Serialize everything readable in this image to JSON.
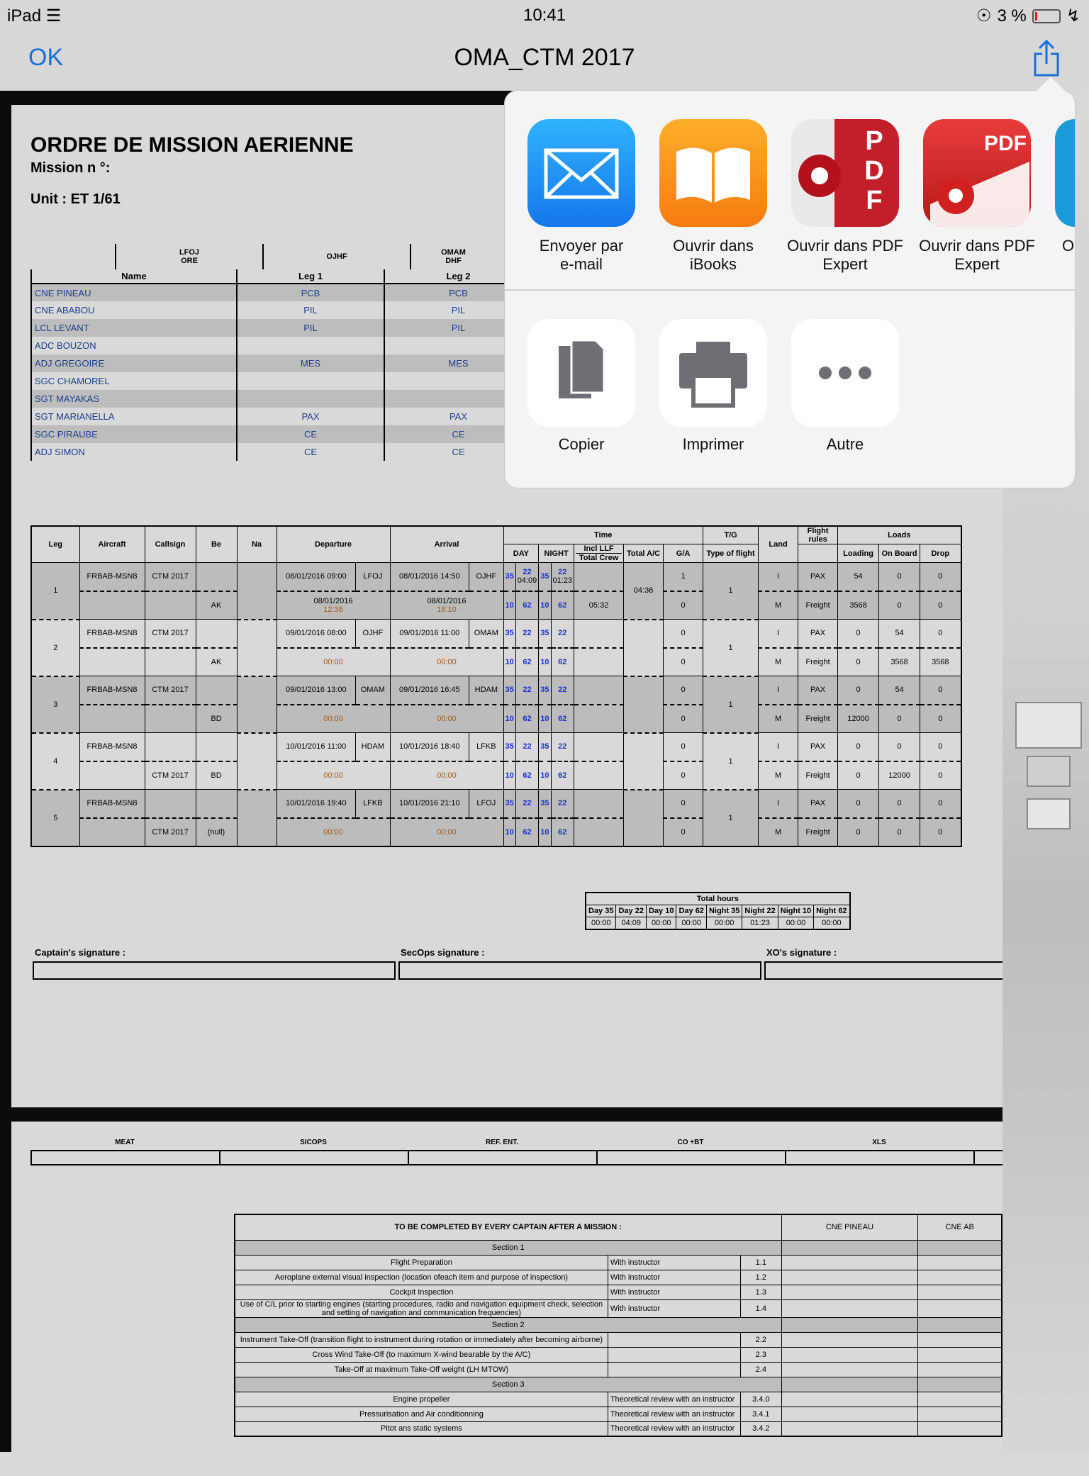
{
  "status": {
    "device": "iPad",
    "time": "10:41",
    "battery": "3 %"
  },
  "nav": {
    "ok": "OK",
    "title": "OMA_CTM 2017"
  },
  "doc": {
    "title": "ORDRE DE MISSION AERIENNE",
    "mission": "Mission n °:",
    "unit": "Unit : ET 1/61",
    "airports": [
      "LFOJ\nORE",
      "OJHF",
      "OMAM\nDHF"
    ],
    "crew_headers": [
      "Name",
      "Leg 1",
      "Leg 2"
    ],
    "crew": [
      [
        "CNE PINEAU",
        "PCB",
        "PCB"
      ],
      [
        "CNE ABABOU",
        "PIL",
        "PIL"
      ],
      [
        "LCL LEVANT",
        "PIL",
        "PIL"
      ],
      [
        "ADC BOUZON",
        "",
        ""
      ],
      [
        "ADJ GREGOIRE",
        "MES",
        "MES"
      ],
      [
        "SGC CHAMOREL",
        "",
        ""
      ],
      [
        "SGT MAYAKAS",
        "",
        ""
      ],
      [
        "SGT MARIANELLA",
        "PAX",
        "PAX"
      ],
      [
        "SGC PIRAUBE",
        "CE",
        "CE"
      ],
      [
        "ADJ SIMON",
        "CE",
        "CE"
      ]
    ],
    "crew_overflow": [
      "CE",
      "CE",
      "CE"
    ],
    "legs_headers": {
      "leg": "Leg",
      "aircraft": "Aircraft",
      "callsign": "Callsign",
      "be": "Be",
      "na": "Na",
      "dep": "Departure",
      "arr": "Arrival",
      "time": "Time",
      "day": "DAY",
      "night": "NIGHT",
      "incl": "Incl LLF",
      "totalcrew": "Total Crew",
      "totalac": "Total A/C",
      "tg": "T/G",
      "ga": "G/A",
      "land": "Land",
      "rules": "Flight rules",
      "type": "Type of flight",
      "loads": "Loads",
      "loading": "Loading",
      "onboard": "On Board",
      "drop": "Drop"
    },
    "legs": [
      {
        "n": "1",
        "ac": "FRBAB-MSN8",
        "cs": "CTM 2017",
        "be": "",
        "dep": "08/01/2016 09:00",
        "depa": "LFOJ",
        "arr": "08/01/2016 14:50",
        "arra": "OJHF",
        "d1": "35",
        "d2": "22",
        "d2b": "04:09",
        "n1": "35",
        "n2": "22",
        "n2b": "01:23",
        "tg": "1",
        "land": "1",
        "totalac": "04:36",
        "ld1": "54",
        "ob1": "0",
        "dr1": "0",
        "be2": "AK",
        "cs2": "",
        "dep2": "08/01/2016",
        "dept": "12:38",
        "arr2": "08/01/2016",
        "arrt": "18:10",
        "tc": "05:32",
        "tg2": "0",
        "ld2": "3568",
        "ob2": "0",
        "dr2": "0"
      },
      {
        "n": "2",
        "ac": "FRBAB-MSN8",
        "cs": "CTM 2017",
        "be": "",
        "dep": "09/01/2016 08:00",
        "depa": "OJHF",
        "arr": "09/01/2016 11:00",
        "arra": "OMAM",
        "d1": "35",
        "d2": "22",
        "d2b": "",
        "n1": "35",
        "n2": "22",
        "n2b": "",
        "tg": "0",
        "land": "1",
        "totalac": "",
        "ld1": "0",
        "ob1": "54",
        "dr1": "0",
        "be2": "AK",
        "cs2": "",
        "dep2": "",
        "dept": "00:00",
        "arr2": "",
        "arrt": "00:00",
        "tc": "",
        "tg2": "0",
        "ld2": "0",
        "ob2": "3568",
        "dr2": "3568"
      },
      {
        "n": "3",
        "ac": "FRBAB-MSN8",
        "cs": "CTM 2017",
        "be": "",
        "dep": "09/01/2016 13:00",
        "depa": "OMAM",
        "arr": "09/01/2016 16:45",
        "arra": "HDAM",
        "d1": "35",
        "d2": "22",
        "d2b": "",
        "n1": "35",
        "n2": "22",
        "n2b": "",
        "tg": "0",
        "land": "1",
        "totalac": "",
        "ld1": "0",
        "ob1": "54",
        "dr1": "0",
        "be2": "BD",
        "cs2": "",
        "dep2": "",
        "dept": "00:00",
        "arr2": "",
        "arrt": "00:00",
        "tc": "",
        "tg2": "0",
        "ld2": "12000",
        "ob2": "0",
        "dr2": "0"
      },
      {
        "n": "4",
        "ac": "FRBAB-MSN8",
        "cs": "",
        "be": "",
        "dep": "10/01/2016 11:00",
        "depa": "HDAM",
        "arr": "10/01/2016 18:40",
        "arra": "LFKB",
        "d1": "35",
        "d2": "22",
        "d2b": "",
        "n1": "35",
        "n2": "22",
        "n2b": "",
        "tg": "0",
        "land": "1",
        "totalac": "",
        "ld1": "0",
        "ob1": "0",
        "dr1": "0",
        "be2": "BD",
        "cs2": "CTM 2017",
        "dep2": "",
        "dept": "00:00",
        "arr2": "",
        "arrt": "00:00",
        "tc": "",
        "tg2": "0",
        "ld2": "0",
        "ob2": "12000",
        "dr2": "0"
      },
      {
        "n": "5",
        "ac": "FRBAB-MSN8",
        "cs": "",
        "be": "",
        "dep": "10/01/2016 19:40",
        "depa": "LFKB",
        "arr": "10/01/2016 21:10",
        "arra": "LFOJ",
        "d1": "35",
        "d2": "22",
        "d2b": "",
        "n1": "35",
        "n2": "22",
        "n2b": "",
        "tg": "0",
        "land": "1",
        "totalac": "",
        "ld1": "0",
        "ob1": "0",
        "dr1": "0",
        "be2": "(null)",
        "cs2": "CTM 2017",
        "dep2": "",
        "dept": "00:00",
        "arr2": "",
        "arrt": "00:00",
        "tc": "",
        "tg2": "0",
        "ld2": "0",
        "ob2": "0",
        "dr2": "0"
      }
    ],
    "leg_sub": {
      "d1": "10",
      "d2": "62",
      "n1": "10",
      "n2": "62",
      "rules1": "I",
      "rules2": "M",
      "pax": "PAX",
      "freight": "Freight"
    },
    "total_hours": {
      "title": "Total hours",
      "cols": [
        "Day 35",
        "Day 22",
        "Day 10",
        "Day 62",
        "Night 35",
        "Night 22",
        "Night 10",
        "Night 62"
      ],
      "vals": [
        "00:00",
        "04:09",
        "00:00",
        "00:00",
        "00:00",
        "01:23",
        "00:00",
        "00:00"
      ]
    },
    "signatures": [
      "Captain's signature :",
      "SecOps signature :",
      "XO's signature :"
    ],
    "p2_headers": [
      "MEAT",
      "SICOPS",
      "REF. ENT.",
      "CO +BT",
      "XLS"
    ],
    "checklist": {
      "title": "TO BE COMPLETED BY EVERY CAPTAIN AFTER A MISSION :",
      "capt1": "CNE PINEAU",
      "capt2": "CNE AB",
      "rows": [
        {
          "sec": "Section 1"
        },
        {
          "t": "Flight Preparation",
          "w": "With instructor",
          "c": "1.1"
        },
        {
          "t": "Aeroplane external visual inspection (location ofeach item and purpose of inspection)",
          "w": "With instructor",
          "c": "1.2"
        },
        {
          "t": "Cockpit Inspection",
          "w": "With instructor",
          "c": "1.3"
        },
        {
          "t": "Use of C/L prior to starting engines (starting procedures, radio and navigation equipment check, selection and setting of navigation and communication frequencies)",
          "w": "With instructor",
          "c": "1.4"
        },
        {
          "sec": "Section 2"
        },
        {
          "t": "Instrument Take-Off (transition flight to instrument during rotation or immediately after becoming airborne)",
          "w": "",
          "c": "2.2"
        },
        {
          "t": "Cross Wind Take-Off (to maximum X-wind bearable by the A/C)",
          "w": "",
          "c": "2.3"
        },
        {
          "t": "Take-Off at maximum Take-Off weight (LH MTOW)",
          "w": "",
          "c": "2.4"
        },
        {
          "sec": "Section 3"
        },
        {
          "t": "Engine propeller",
          "w": "Theoretical review with an instructor",
          "c": "3.4.0"
        },
        {
          "t": "Pressurisation and Air conditionning",
          "w": "Theoretical review with an instructor",
          "c": "3.4.1"
        },
        {
          "t": "Pitot ans static systems",
          "w": "Theoretical review with an instructor",
          "c": "3.4.2"
        }
      ]
    }
  },
  "share": {
    "apps": [
      "Envoyer par\ne-mail",
      "Ouvrir dans\niBooks",
      "Ouvrir dans PDF\nExpert",
      "Ouvrir dans PDF\nExpert",
      "O"
    ],
    "actions": [
      "Copier",
      "Imprimer",
      "Autre"
    ],
    "pdf_label": "PDF",
    "colors": {
      "mail": "#1d8ef5",
      "ibooks": "#fb8b10",
      "pdf": "#d42a2a",
      "ok": "#1a6fd6"
    }
  }
}
